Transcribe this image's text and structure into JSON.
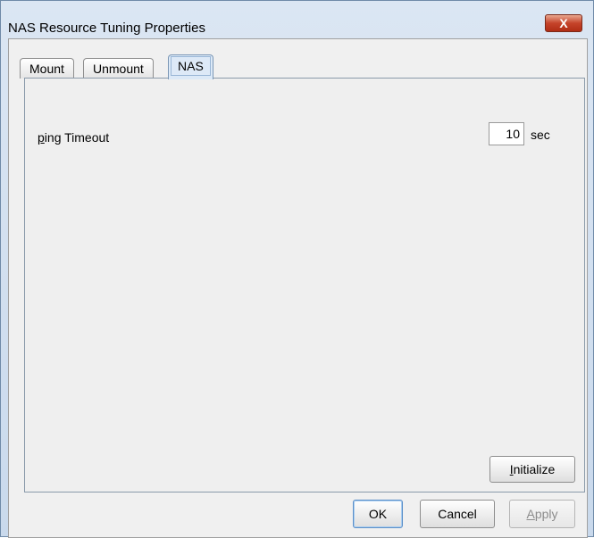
{
  "window": {
    "title": "NAS Resource Tuning Properties",
    "close_glyph": "X",
    "accent": "#c5432a"
  },
  "tabs": [
    {
      "label": "Mount",
      "active": false
    },
    {
      "label": "Unmount",
      "active": false
    },
    {
      "label": "NAS",
      "active": true
    }
  ],
  "nas": {
    "ping_timeout": {
      "label_mnemonic": "p",
      "label_rest": "ing Timeout",
      "value": "10",
      "unit": "sec"
    },
    "initialize": {
      "mnemonic": "I",
      "rest": "nitialize"
    }
  },
  "footer": {
    "ok": "OK",
    "cancel": "Cancel",
    "apply": {
      "mnemonic": "A",
      "rest": "pply",
      "enabled": false
    }
  }
}
